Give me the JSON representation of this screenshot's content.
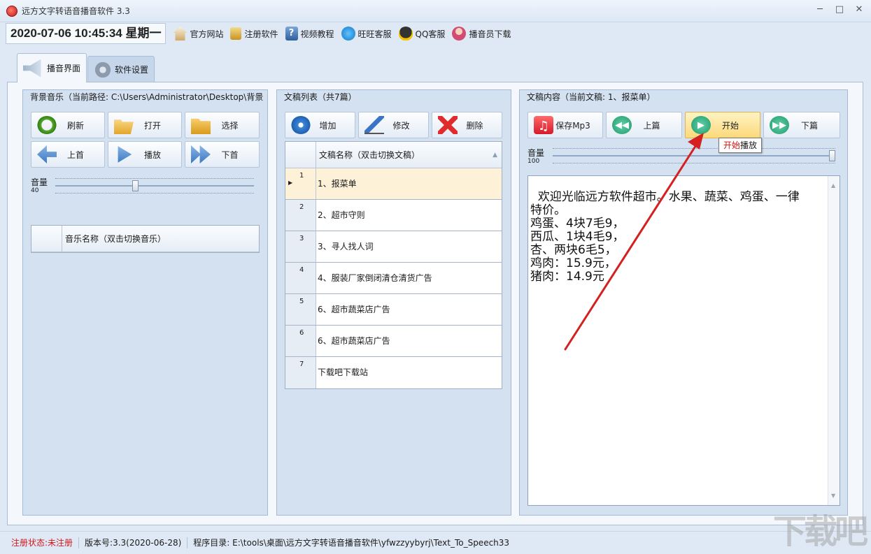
{
  "window": {
    "title": "远方文字转语音播音软件 3.3",
    "minimize": "─",
    "maximize": "□",
    "close": "✕"
  },
  "toolbar": {
    "datetime": "2020-07-06 10:45:34 星期一",
    "items": [
      {
        "label": "官方网站",
        "icon": "home-icon"
      },
      {
        "label": "注册软件",
        "icon": "lock-icon"
      },
      {
        "label": "视频教程",
        "icon": "help-icon"
      },
      {
        "label": "旺旺客服",
        "icon": "wangwang-icon"
      },
      {
        "label": "QQ客服",
        "icon": "qq-icon"
      },
      {
        "label": "播音员下载",
        "icon": "user-icon"
      }
    ],
    "help_glyph": "?"
  },
  "tabs": [
    {
      "label": "播音界面",
      "active": true
    },
    {
      "label": "软件设置",
      "active": false
    }
  ],
  "music_panel": {
    "title": "背景音乐（当前路径: C:\\Users\\Administrator\\Desktop\\背景",
    "buttons": {
      "refresh": "刷新",
      "open": "打开",
      "select": "选择",
      "prev": "上首",
      "play": "播放",
      "next": "下首"
    },
    "volume_label": "音量",
    "volume_value": "40",
    "volume_fraction": 0.4,
    "list_header": "音乐名称（双击切换音乐）"
  },
  "script_panel": {
    "title": "文稿列表（共7篇）",
    "buttons": {
      "add": "增加",
      "edit": "修改",
      "delete": "删除"
    },
    "list_header": "文稿名称（双击切换文稿）",
    "sort_glyph": "▲",
    "rows": [
      {
        "num": "1",
        "name": "1、报菜单",
        "selected": true
      },
      {
        "num": "2",
        "name": "2、超市守则",
        "selected": false
      },
      {
        "num": "3",
        "name": "3、寻人找人词",
        "selected": false
      },
      {
        "num": "4",
        "name": "4、服装厂家倒闭清仓清货广告",
        "selected": false
      },
      {
        "num": "5",
        "name": "6、超市蔬菜店广告",
        "selected": false
      },
      {
        "num": "6",
        "name": "6、超市蔬菜店广告",
        "selected": false
      },
      {
        "num": "7",
        "name": "下载吧下载站",
        "selected": false
      }
    ]
  },
  "content_panel": {
    "title": "文稿内容（当前文稿: 1、报菜单）",
    "buttons": {
      "save_mp3": "保存Mp3",
      "prev": "上篇",
      "start": "开始",
      "next": "下篇"
    },
    "music_glyph": "♫",
    "prev_glyph": "◀◀",
    "start_glyph": "▶",
    "next_glyph": "▶▶",
    "volume_label": "音量",
    "volume_value": "100",
    "volume_fraction": 1.0,
    "text": "欢迎光临远方软件超市。水果、蔬菜、鸡蛋、一律\n特价。\n鸡蛋、4块7毛9，\n西瓜、1块4毛9，\n杏、两块6毛5，\n鸡肉：15.9元，\n猪肉：14.9元",
    "scroll_up": "▲",
    "scroll_down": "▼"
  },
  "tooltip": {
    "highlight": "开始",
    "rest": "播放"
  },
  "statusbar": {
    "reg_status": "注册状态:未注册",
    "version": "版本号:3.3(2020-06-28)",
    "program_dir": "程序目录: E:\\tools\\桌面\\远方文字转语音播音软件\\yfwzzyybyrj\\Text_To_Speech33"
  },
  "watermark": "下载吧",
  "colors": {
    "annotation_arrow": "#d42020",
    "start_button_bg": "#fde9a8"
  }
}
